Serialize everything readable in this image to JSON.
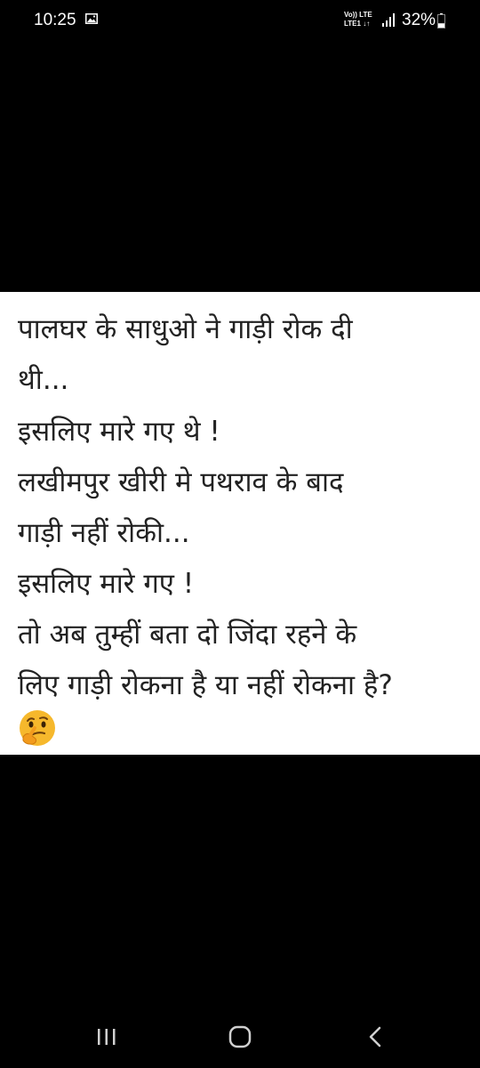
{
  "status_bar": {
    "time": "10:25",
    "network_top": "Vo)) LTE",
    "network_bottom": "LTE1 ↓↑",
    "battery_percent": "32%",
    "battery_level": 0.32
  },
  "post": {
    "lines": [
      "पालघर के साधुओ ने गाड़ी रोक दी",
      "थी...",
      "इसलिए मारे गए थे !",
      "लखीमपुर खीरी मे पथराव के बाद",
      "गाड़ी नहीं रोकी...",
      "इसलिए मारे गए !",
      "तो अब तुम्हीं बता दो जिंदा रहने के",
      "लिए गाड़ी रोकना है या नहीं रोकना है?"
    ],
    "emoji_icon": "thinking-face-icon"
  },
  "nav_bar": {
    "icons": [
      "recent-apps-icon",
      "home-icon",
      "back-icon"
    ]
  },
  "colors": {
    "background": "#000000",
    "card": "#ffffff",
    "text": "#222222",
    "emoji": "#f6b82c"
  }
}
